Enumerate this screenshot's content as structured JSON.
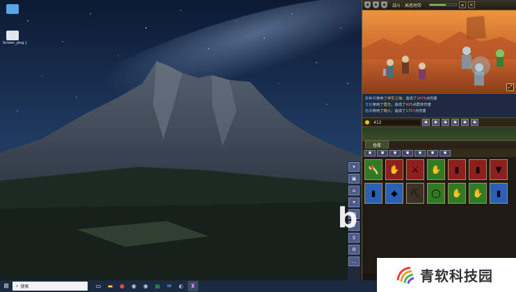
{
  "desktop": {
    "icons": [
      {
        "label": "",
        "icon": "computer-icon"
      },
      {
        "label": "Screen_plug ]",
        "icon": "file-icon"
      }
    ]
  },
  "taskbar": {
    "search_text": "搜索",
    "apps": [
      "task-view-icon",
      "file-explorer-icon",
      "chrome-icon",
      "steam-icon",
      "steam-icon",
      "excel-icon",
      "mail-icon",
      "app-icon",
      "game-icon"
    ]
  },
  "game": {
    "stage_title": "战斗 - 高塔地带",
    "health_fraction": 0.6,
    "battle_log": [
      {
        "actor": "斯蒂芬",
        "verb": "使用了",
        "skill": "神圣之锤",
        "result": "，造成了",
        "amount": "1676",
        "suffix": "点伤害"
      },
      {
        "actor": "艾伦",
        "verb": "使用了",
        "skill": "雷击",
        "result": "，造成了",
        "amount": "405",
        "suffix": "点群体伤害"
      },
      {
        "actor": "哈泽",
        "verb": "使用了",
        "skill": "暗火",
        "result": "，造成了",
        "amount": "1757",
        "suffix": "点伤害"
      }
    ],
    "gold": "412",
    "warehouse_tab": "仓库",
    "colors": {
      "accent": "#a89160",
      "slot_red": "#8e1f1f",
      "slot_green": "#2f7a22",
      "slot_blue": "#2b5fb3"
    }
  },
  "watermark": {
    "text": "青软科技园"
  }
}
